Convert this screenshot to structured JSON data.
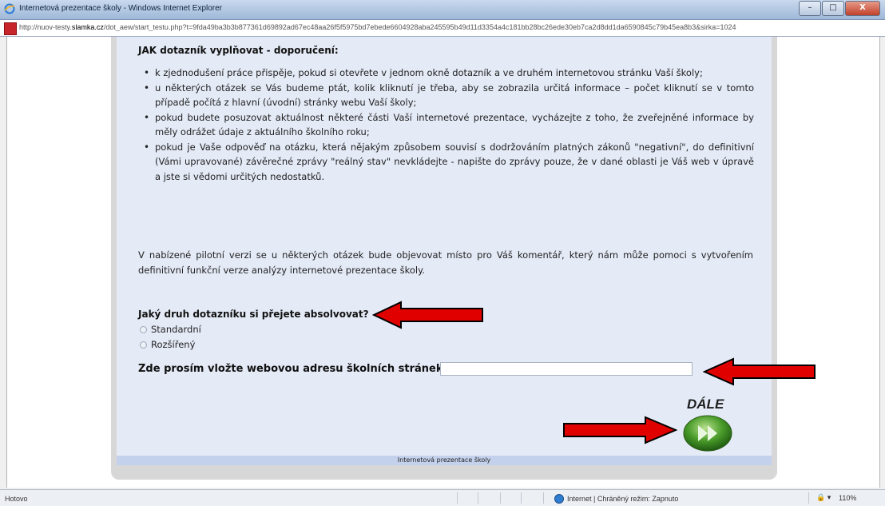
{
  "window": {
    "title": "Internetová prezentace školy - Windows Internet Explorer",
    "minimize": "–",
    "maximize": "□",
    "close": "X"
  },
  "address": {
    "url_prefix": "http://nuov-testy.",
    "url_domain": "slamka.cz",
    "url_rest": "/dot_aew/start_testu.php?t=9fda49ba3b3b877361d69892ad67ec48aa26f5f5975bd7ebede6604928aba245595b49d11d3354a4c181bb28bc26ede30eb7ca2d8dd1da6590845c79b45ea8b3&sirka=1024"
  },
  "page": {
    "heading": "JAK dotazník vyplňovat - doporučení:",
    "bullets": [
      "k zjednodušení práce přispěje, pokud si otevřete v jednom okně dotazník a ve druhém internetovou stránku Vaší školy;",
      "u některých otázek se Vás budeme ptát, kolik kliknutí je třeba, aby se zobrazila určitá informace – počet kliknutí se v tomto případě počítá z hlavní (úvodní) stránky webu Vaší školy;",
      "pokud budete posuzovat aktuálnost některé části Vaší internetové prezentace, vycházejte z toho, že zveřejněné informace by měly odrážet údaje z aktuálního školního roku;",
      "pokud je Vaše odpověď na otázku, která nějakým způsobem souvisí s dodržováním platných zákonů \"negativní\", do definitivní (Vámi upravované) závěrečné zprávy \"reálný stav\" nevkládejte - napište do zprávy pouze, že v dané oblasti je Váš web v úpravě a jste si vědomi určitých nedostatků."
    ],
    "paragraph": "V nabízené pilotní verzi se u některých otázek bude objevovat místo pro Váš komentář, který nám může pomoci s vytvořením definitivní funkční verze analýzy internetové prezentace školy.",
    "question": "Jaký druh dotazníku si přejete absolvovat?",
    "options": [
      "Standardní",
      "Rozšířený"
    ],
    "url_label": "Zde prosím vložte webovou adresu školních stránek:",
    "url_value": "",
    "next_label": "DÁLE",
    "footer": "Internetová prezentace školy"
  },
  "status": {
    "text": "Hotovo",
    "zone": "Internet | Chráněný režim: Zapnuto",
    "zoom": "110%",
    "addon": "🔒 ▾"
  },
  "colors": {
    "panel": "#e4eaf6",
    "arrow_fill": "#e00000",
    "next_button": "#4a9c2a"
  },
  "icons": [
    "ie-icon",
    "site-icon",
    "globe-icon",
    "next-arrow-icon",
    "radio-icon"
  ]
}
